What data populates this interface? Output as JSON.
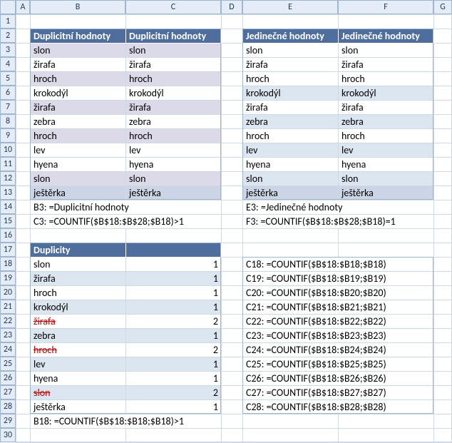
{
  "columns": [
    "A",
    "B",
    "C",
    "D",
    "E",
    "F",
    "G"
  ],
  "row_count": 30,
  "top_tables": {
    "dup": {
      "header_b": "Duplicitní hodnoty",
      "header_c": "Duplicitní hodnoty",
      "rows": [
        {
          "b": "slon",
          "c": "slon",
          "band": "lav"
        },
        {
          "b": "žirafa",
          "c": "žirafa",
          "band": "wht"
        },
        {
          "b": "hroch",
          "c": "hroch",
          "band": "lav"
        },
        {
          "b": "krokodýl",
          "c": "krokodýl",
          "band": "wht"
        },
        {
          "b": "žirafa",
          "c": "žirafa",
          "band": "lav"
        },
        {
          "b": "zebra",
          "c": "zebra",
          "band": "wht"
        },
        {
          "b": "hroch",
          "c": "hroch",
          "band": "lav"
        },
        {
          "b": "lev",
          "c": "lev",
          "band": "wht"
        },
        {
          "b": "hyena",
          "c": "hyena",
          "band": "wht"
        },
        {
          "b": "slon",
          "c": "slon",
          "band": "lav"
        },
        {
          "b": "ještěrka",
          "c": "ještěrka",
          "band": "dark"
        }
      ],
      "note_b14": "B3: =Duplicitní hodnoty",
      "note_b15": "C3: =COUNTIF($B$18:$B$28;$B18)>1"
    },
    "uniq": {
      "header_e": "Jedinečné hodnoty",
      "header_f": "Jedinečné hodnoty",
      "rows": [
        {
          "e": "slon",
          "f": "slon",
          "band": "wht"
        },
        {
          "e": "žirafa",
          "f": "žirafa",
          "band": "wht"
        },
        {
          "e": "hroch",
          "f": "hroch",
          "band": "wht"
        },
        {
          "e": "krokodýl",
          "f": "krokodýl",
          "band": "blu"
        },
        {
          "e": "žirafa",
          "f": "žirafa",
          "band": "wht"
        },
        {
          "e": "zebra",
          "f": "zebra",
          "band": "blu"
        },
        {
          "e": "hroch",
          "f": "hroch",
          "band": "wht"
        },
        {
          "e": "lev",
          "f": "lev",
          "band": "blu"
        },
        {
          "e": "hyena",
          "f": "hyena",
          "band": "wht"
        },
        {
          "e": "slon",
          "f": "slon",
          "band": "blu"
        },
        {
          "e": "ještěrka",
          "f": "ještěrka",
          "band": "dark"
        }
      ],
      "note_e14": "E3: =Jedinečné hodnoty",
      "note_e15": "F3: =COUNTIF($B$18:$B$28;$B18)=1"
    }
  },
  "lower_table": {
    "header_b": "Duplicity",
    "rows": [
      {
        "b": "slon",
        "c": 1,
        "strike": false,
        "band": "wht",
        "ef": "C18: =COUNTIF($B$18:$B18;$B18)"
      },
      {
        "b": "žirafa",
        "c": 1,
        "strike": false,
        "band": "blu",
        "ef": "C19: =COUNTIF($B$18:$B19;$B19)"
      },
      {
        "b": "hroch",
        "c": 1,
        "strike": false,
        "band": "wht",
        "ef": "C20: =COUNTIF($B$18:$B20;$B20)"
      },
      {
        "b": "krokodýl",
        "c": 1,
        "strike": false,
        "band": "blu",
        "ef": "C21: =COUNTIF($B$18:$B21;$B21)"
      },
      {
        "b": "žirafa",
        "c": 2,
        "strike": true,
        "band": "wht",
        "ef": "C22: =COUNTIF($B$18:$B22;$B22)"
      },
      {
        "b": "zebra",
        "c": 1,
        "strike": false,
        "band": "blu",
        "ef": "C23: =COUNTIF($B$18:$B23;$B23)"
      },
      {
        "b": "hroch",
        "c": 2,
        "strike": true,
        "band": "wht",
        "ef": "C24: =COUNTIF($B$18:$B24;$B24)"
      },
      {
        "b": "lev",
        "c": 1,
        "strike": false,
        "band": "blu",
        "ef": "C25: =COUNTIF($B$18:$B25;$B25)"
      },
      {
        "b": "hyena",
        "c": 1,
        "strike": false,
        "band": "wht",
        "ef": "C26: =COUNTIF($B$18:$B26;$B26)"
      },
      {
        "b": "slon",
        "c": 2,
        "strike": true,
        "band": "blu",
        "ef": "C27: =COUNTIF($B$18:$B27;$B27)"
      },
      {
        "b": "ještěrka",
        "c": 1,
        "strike": false,
        "band": "wht",
        "ef": "C28: =COUNTIF($B$18:$B28;$B28)"
      }
    ],
    "note_b29": "B18: =COUNTIF($B$18:$B18;$B18)>1"
  }
}
